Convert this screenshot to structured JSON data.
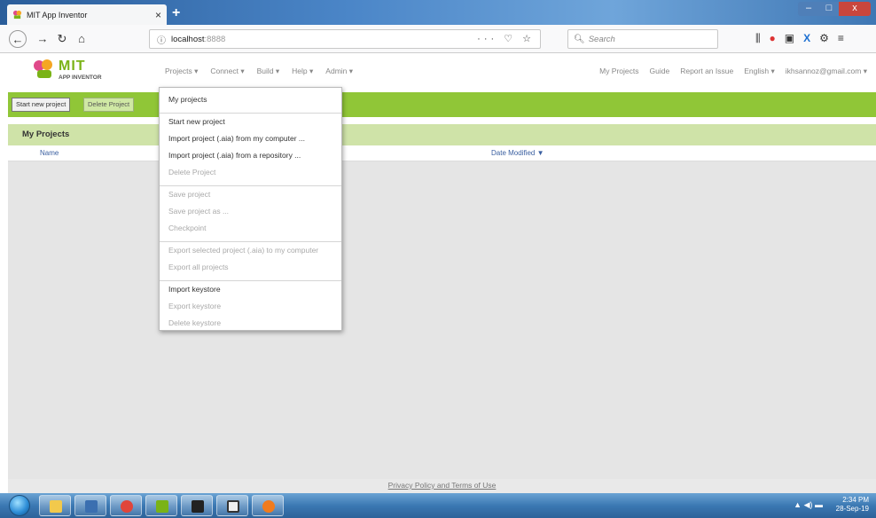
{
  "browser": {
    "tab_title": "MIT App Inventor",
    "tab_close": "×",
    "new_tab": "+",
    "url_info_icon": "ⓘ",
    "url_host": "localhost",
    "url_port": ":8888",
    "url_actions": "··· ♡ ☆",
    "search_placeholder": "Search",
    "window_min": "–",
    "window_max": "□",
    "window_close": "x"
  },
  "app": {
    "logo_title": "MIT",
    "logo_subtitle": "APP INVENTOR",
    "menu": [
      {
        "label": "Projects ▾"
      },
      {
        "label": "Connect ▾"
      },
      {
        "label": "Build ▾"
      },
      {
        "label": "Help ▾"
      },
      {
        "label": "Admin ▾"
      }
    ],
    "right_menu": [
      {
        "label": "My Projects"
      },
      {
        "label": "Guide"
      },
      {
        "label": "Report an Issue"
      },
      {
        "label": "English ▾"
      },
      {
        "label": "ikhsannoz@gmail.com ▾"
      }
    ],
    "actions": {
      "start_new_project": "Start new project",
      "delete_project": "Delete Project"
    },
    "projects_panel": {
      "title": "My Projects",
      "col_name": "Name",
      "col_date": "Date Modified ▼"
    },
    "footer_link": "Privacy Policy and Terms of Use"
  },
  "projects_dropdown": {
    "groups": [
      [
        {
          "label": "My projects",
          "enabled": true
        }
      ],
      [
        {
          "label": "Start new project",
          "enabled": true
        },
        {
          "label": "Import project (.aia) from my computer ...",
          "enabled": true
        },
        {
          "label": "Import project (.aia) from a repository ...",
          "enabled": true
        },
        {
          "label": "Delete Project",
          "enabled": false
        }
      ],
      [
        {
          "label": "Save project",
          "enabled": false
        },
        {
          "label": "Save project as ...",
          "enabled": false
        },
        {
          "label": "Checkpoint",
          "enabled": false
        }
      ],
      [
        {
          "label": "Export selected project (.aia) to my computer",
          "enabled": false
        },
        {
          "label": "Export all projects",
          "enabled": false
        }
      ],
      [
        {
          "label": "Import keystore",
          "enabled": true
        },
        {
          "label": "Export keystore",
          "enabled": false
        },
        {
          "label": "Delete keystore",
          "enabled": false
        }
      ]
    ]
  },
  "taskbar": {
    "time": "2:34 PM",
    "date": "28-Sep-19"
  },
  "colors": {
    "accent_green": "#90c637",
    "panel_green": "#cfe3a8",
    "logo_green": "#7ab317"
  }
}
